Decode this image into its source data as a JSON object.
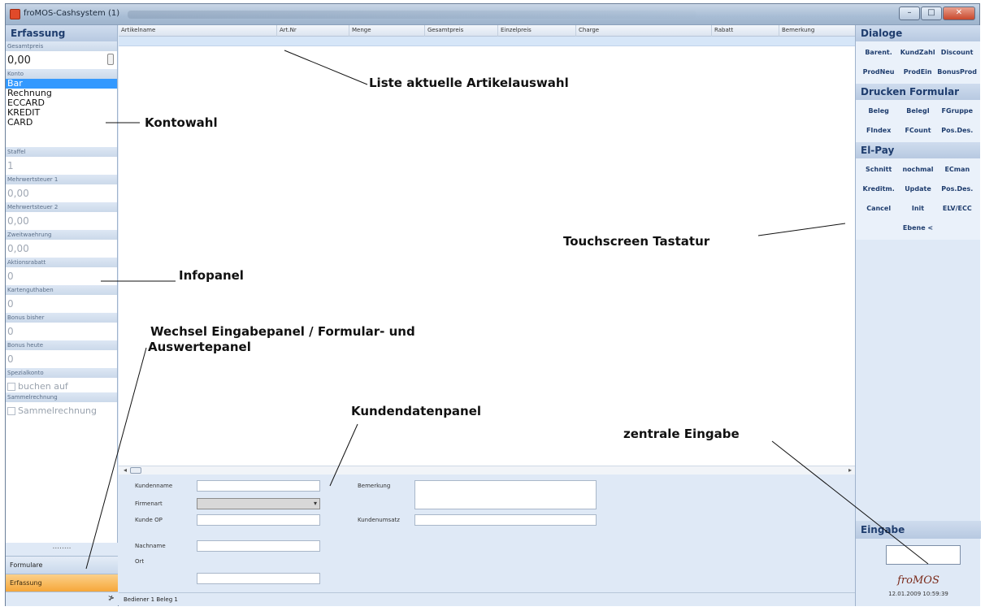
{
  "window": {
    "title": "froMOS-Cashsystem (1)",
    "buttons": {
      "minimize": "–",
      "maximize": "□",
      "close": "✕"
    }
  },
  "left_panel": {
    "header": "Erfassung",
    "gesamtpreis_label": "Gesamtpreis",
    "gesamtpreis_value": "0,00",
    "konto_label": "Konto",
    "konto_items": [
      "Bar",
      "Rechnung",
      "ECCARD",
      "KREDIT",
      "CARD"
    ],
    "konto_selected": "Bar",
    "staffel_label": "Staffel",
    "staffel_value": "1",
    "mwst1_label": "Mehrwertsteuer 1",
    "mwst1_value": "0,00",
    "mwst2_label": "Mehrwertsteuer 2",
    "mwst2_value": "0,00",
    "zweitwaehrung_label": "Zweitwaehrung",
    "zweitwaehrung_value": "0,00",
    "aktionsrabatt_label": "Aktionsrabatt",
    "aktionsrabatt_value": "0",
    "kartenguthaben_label": "Kartenguthaben",
    "kartenguthaben_value": "0",
    "bonus_bisher_label": "Bonus bisher",
    "bonus_bisher_value": "0",
    "bonus_heute_label": "Bonus heute",
    "bonus_heute_value": "0",
    "spezialkonto_label": "Spezialkonto",
    "buchen_auf": "buchen auf",
    "sammelrechnung_label": "Sammelrechnung",
    "sammelrechnung_checkbox": "Sammelrechnung",
    "dots": "........",
    "nav_formulare": "Formulare",
    "nav_erfassung": "Erfassung",
    "chevron": "≯"
  },
  "grid": {
    "columns": [
      "Artikelname",
      "Art.Nr",
      "Menge",
      "Gesamtpreis",
      "Einzelpreis",
      "Charge",
      "Rabatt",
      "Bemerkung"
    ]
  },
  "customer_panel": {
    "kundenname": "Kundenname",
    "firmenart": "Firmenart",
    "kunde_op": "Kunde OP",
    "nachname": "Nachname",
    "ort": "Ort",
    "bemerkung": "Bemerkung",
    "kundenumsatz": "Kundenumsatz"
  },
  "status_bar": {
    "text": "Bediener 1 Beleg  1"
  },
  "right_panel": {
    "dialoge_header": "Dialoge",
    "dialoge_buttons": [
      "Barent.",
      "KundZahl",
      "Discount",
      "ProdNeu",
      "ProdEin",
      "BonusProd"
    ],
    "drucken_header": "Drucken Formular",
    "drucken_buttons": [
      "Beleg",
      "BelegI",
      "FGruppe",
      "FIndex",
      "FCount",
      "Pos.Des."
    ],
    "elpay_header": "El-Pay",
    "elpay_buttons": [
      "Schnitt",
      "nochmal",
      "ECman",
      "Kreditm.",
      "Update",
      "Pos.Des.",
      "Cancel",
      "Init",
      "ELV/ECC"
    ],
    "ebene_button": "Ebene <",
    "eingabe_header": "Eingabe",
    "logo": "froMOS",
    "datetime": "12.01.2009 10:59:39"
  },
  "annotations": {
    "liste": "Liste aktuelle Artikelauswahl",
    "kontowahl": "Kontowahl",
    "touchscreen": "Touchscreen Tastatur",
    "infopanel": "Infopanel",
    "wechsel_line1": "Wechsel Eingabepanel / Formular- und",
    "wechsel_line2": "Auswertepanel",
    "kundendaten": "Kundendatenpanel",
    "zentrale": "zentrale Eingabe"
  }
}
